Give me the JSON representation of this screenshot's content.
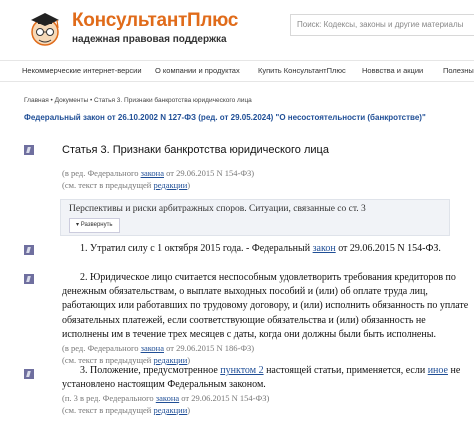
{
  "header": {
    "brand": "КонсультантПлюс",
    "tagline": "надежная правовая поддержка",
    "search_placeholder": "Поиск: Кодексы, законы и другие материалы"
  },
  "nav": {
    "items": [
      "Некоммерческие интернет-версии",
      "О компании и продуктах",
      "Купить КонсультантПлюс",
      "Новвства и акции",
      "Полезны"
    ]
  },
  "breadcrumb": {
    "home": "Главная",
    "sep1": " • ",
    "docs": "Документы",
    "sep2": " • ",
    "current": "Статья 3. Признаки банкротства юридического лица"
  },
  "document": {
    "title": "Федеральный закон от 26.10.2002 N 127-ФЗ (ред. от 29.05.2024) \"О несостоятельности (банкротстве)\""
  },
  "article": {
    "heading": "Статья 3. Признаки банкротства юридического лица",
    "edition_prefix": "(в ред. Федерального ",
    "edition_link": "закона",
    "edition_suffix": " от 29.06.2015 N 154-ФЗ)",
    "prev_prefix": "(см. текст в предыдущей ",
    "prev_link": "редакции",
    "prev_suffix": ")"
  },
  "commentary": {
    "text": "Перспективы и риски арбитражных споров. Ситуации, связанные со ст. 3",
    "expand_label": "Развернуть"
  },
  "paragraphs": {
    "p1_prefix": "1. Утратил силу с 1 октября 2015 года. - Федеральный ",
    "p1_link": "закон",
    "p1_suffix": " от 29.06.2015 N 154-ФЗ.",
    "p2_lines": [
      "2. Юридическое лицо считается неспособным удовлетворить требования кредиторов по",
      "денежным обязательствам, о выплате выходных пособий и (или) об оплате труда лиц,",
      "работающих или работавших по трудовому договору, и (или) исполнить обязанность по уплате",
      "обязательных платежей, если соответствующие обязательства и (или) обязанность не",
      "исполнены им в течение трех месяцев с даты, когда они должны были быть исполнены."
    ],
    "p2_ed_prefix": "(в ред. Федерального ",
    "p2_ed_link": "закона",
    "p2_ed_suffix": " от 29.06.2015 N 186-ФЗ)",
    "p2_prev_prefix": "(см. текст в предыдущей ",
    "p2_prev_link": "редакции",
    "p2_prev_suffix": ")",
    "p3_l1_a": "3. Положение, предусмотренное ",
    "p3_l1_link1": "пунктом 2",
    "p3_l1_b": " настоящей статьи, применяется, если ",
    "p3_l1_link2": "иное",
    "p3_l1_c": " не",
    "p3_l2": "установлено настоящим Федеральным законом.",
    "p3_ed_prefix": "(п. 3 в ред. Федерального ",
    "p3_ed_link": "закона",
    "p3_ed_suffix": " от 29.06.2015 N 154-ФЗ)",
    "p3_prev_prefix": "(см. текст в предыдущей ",
    "p3_prev_link": "редакции",
    "p3_prev_suffix": ")"
  },
  "colors": {
    "brand_orange": "#e06b1a",
    "link_blue": "#1f4e96",
    "marker_purple": "#6f6f9f"
  },
  "icons": [
    "mascot-logo-icon",
    "paragraph-marker-icon"
  ]
}
